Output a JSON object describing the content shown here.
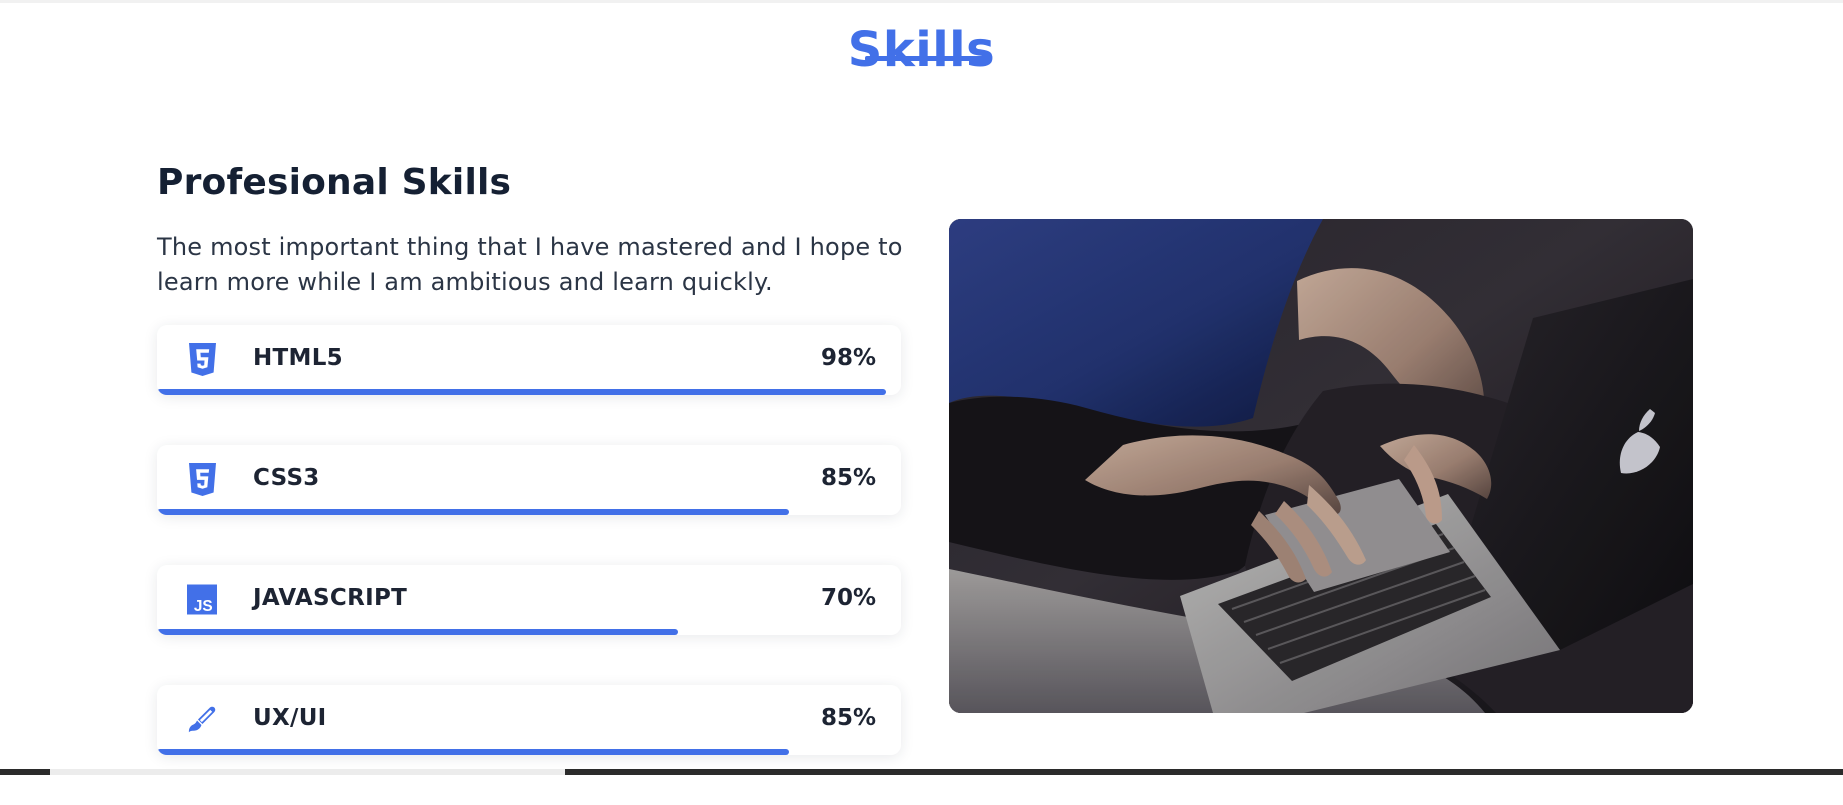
{
  "section": {
    "title": "Skills"
  },
  "profession": {
    "heading": "Profesional Skills",
    "description": "The most important thing that I have mastered and I hope to learn more while I am ambitious and learn quickly."
  },
  "skills": [
    {
      "name": "HTML5",
      "percent_label": "98%",
      "level": 0.98,
      "icon": "html5-icon"
    },
    {
      "name": "CSS3",
      "percent_label": "85%",
      "level": 0.85,
      "icon": "css3-icon"
    },
    {
      "name": "JAVASCRIPT",
      "percent_label": "70%",
      "level": 0.7,
      "icon": "javascript-icon"
    },
    {
      "name": "UX/UI",
      "percent_label": "85%",
      "level": 0.85,
      "icon": "brush-icon"
    }
  ],
  "icons": {
    "js_text": "JS"
  },
  "colors": {
    "accent": "#4270e8",
    "text": "#152033",
    "muted_text": "#2b3545"
  }
}
